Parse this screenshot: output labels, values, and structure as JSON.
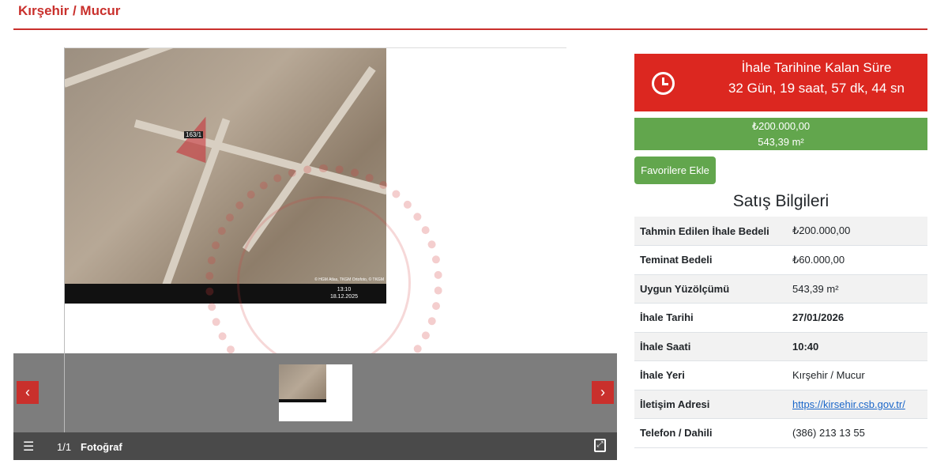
{
  "page": {
    "title": "Kırşehir / Mucur"
  },
  "gallery": {
    "photo": {
      "parcel_label": "163/1",
      "clock_time": "13:10",
      "clock_date": "18.12.2025",
      "attribution": "© HGM Atlas, TKGM Ortofoto, © TKGM"
    },
    "prev_icon": "‹",
    "next_icon": "›",
    "counter": "1/1",
    "caption": "Fotoğraf",
    "menu_icon": "☰",
    "fullscreen_icon": "⤢"
  },
  "timer": {
    "title": "İhale Tarihine Kalan Süre",
    "remaining": "32 Gün, 19 saat, 57 dk, 44 sn",
    "icon": "clock-icon"
  },
  "price": {
    "amount": "₺200.000,00",
    "area": "543,39 m²"
  },
  "favorite_label": "Favorilere Ekle",
  "section_title": "Satış Bilgileri",
  "rows": [
    {
      "label": "Tahmin Edilen İhale Bedeli",
      "value": "₺200.000,00"
    },
    {
      "label": "Teminat Bedeli",
      "value": "₺60.000,00"
    },
    {
      "label": "Uygun Yüzölçümü",
      "value": "543,39 m²"
    },
    {
      "label": "İhale Tarihi",
      "value": "27/01/2026"
    },
    {
      "label": "İhale Saati",
      "value": "10:40"
    },
    {
      "label": "İhale Yeri",
      "value": "Kırşehir / Mucur"
    },
    {
      "label": "İletişim Adresi",
      "value": "https://kirsehir.csb.gov.tr/"
    },
    {
      "label": "Telefon / Dahili",
      "value": "(386) 213 13 55"
    }
  ],
  "colors": {
    "accent": "#c9302c",
    "timer_bg": "#dc2720",
    "green": "#62a64d"
  }
}
